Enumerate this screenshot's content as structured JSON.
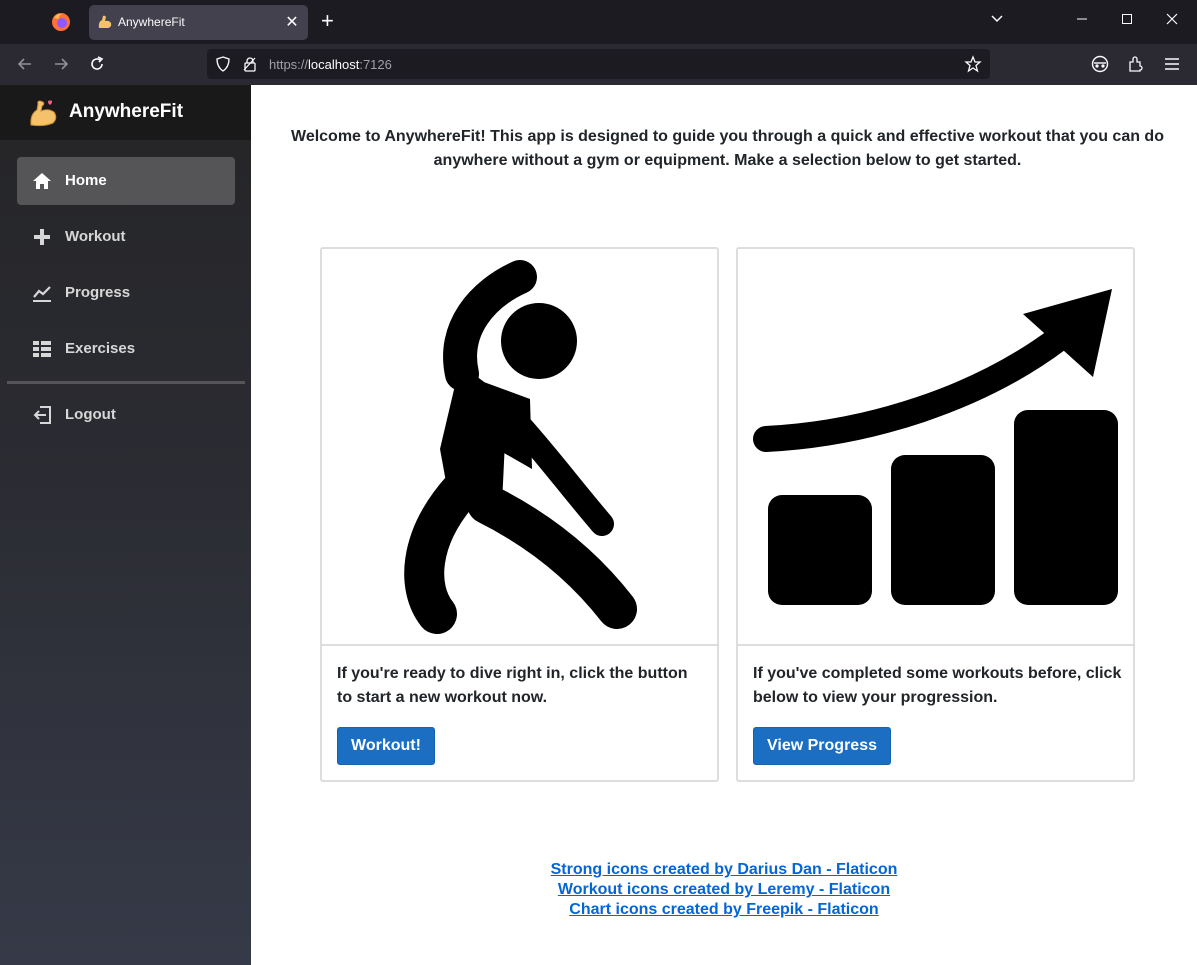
{
  "browser": {
    "tab_title": "AnywhereFit",
    "url_scheme": "https://",
    "url_host": "localhost",
    "url_port": ":7126"
  },
  "sidebar": {
    "brand": "AnywhereFit",
    "items": [
      {
        "label": "Home",
        "icon": "home-icon",
        "active": true
      },
      {
        "label": "Workout",
        "icon": "plus-icon"
      },
      {
        "label": "Progress",
        "icon": "chart-line-icon"
      },
      {
        "label": "Exercises",
        "icon": "list-icon"
      }
    ],
    "logout_label": "Logout"
  },
  "main": {
    "welcome": "Welcome to AnywhereFit! This app is designed to guide you through a quick and effective workout that you can do anywhere without a gym or equipment. Make a selection below to get started.",
    "cards": [
      {
        "text": "If you're ready to dive right in, click the button to start a new workout now.",
        "button": "Workout!",
        "icon": "stretching-person-icon"
      },
      {
        "text": "If you've completed some workouts before, click below to view your progression.",
        "button": "View Progress",
        "icon": "growth-chart-icon"
      }
    ],
    "credits": [
      "Strong icons created by Darius Dan - Flaticon",
      "Workout icons created by Leremy - Flaticon",
      "Chart icons created by Freepik - Flaticon"
    ]
  },
  "colors": {
    "primary_button": "#1b6ec2",
    "link": "#0366d6",
    "sidebar_active": "#555557"
  }
}
